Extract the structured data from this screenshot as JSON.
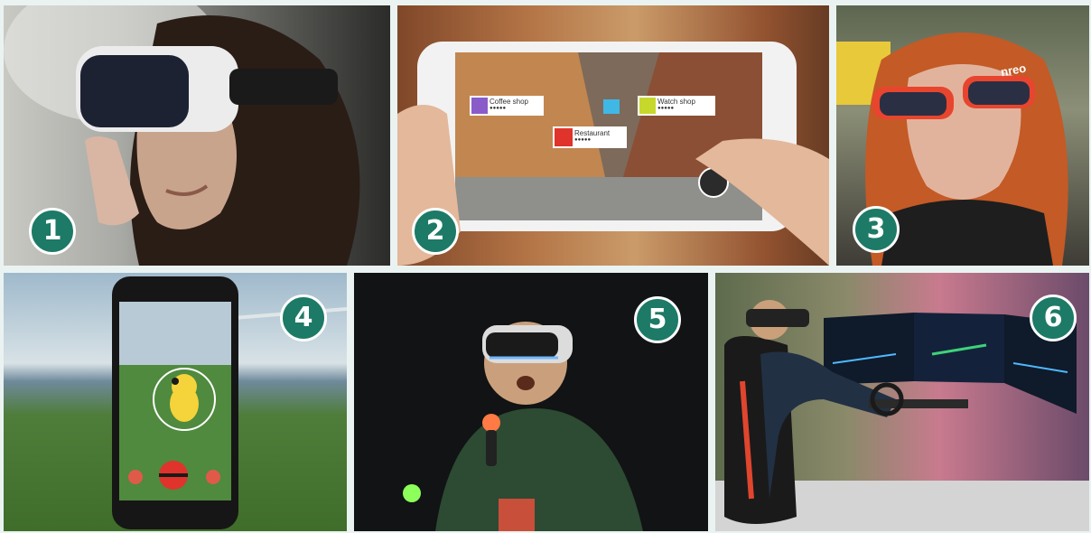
{
  "tiles": [
    {
      "number": "1",
      "subject": "vr-headset-woman"
    },
    {
      "number": "2",
      "subject": "ar-phone-street",
      "ar_labels": {
        "coffee": "Coffee shop",
        "watch": "Watch shop",
        "restaurant": "Restaurant",
        "rating": "●●●●●"
      }
    },
    {
      "number": "3",
      "subject": "ar-glasses-woman",
      "glasses_brand": "nreo"
    },
    {
      "number": "4",
      "subject": "pokemon-go-phone"
    },
    {
      "number": "5",
      "subject": "vr-controllers-man"
    },
    {
      "number": "6",
      "subject": "racing-simulator"
    }
  ],
  "colors": {
    "badge": "#1c7a66",
    "badge_border": "#ffffff",
    "background": "#eaf3f1"
  }
}
